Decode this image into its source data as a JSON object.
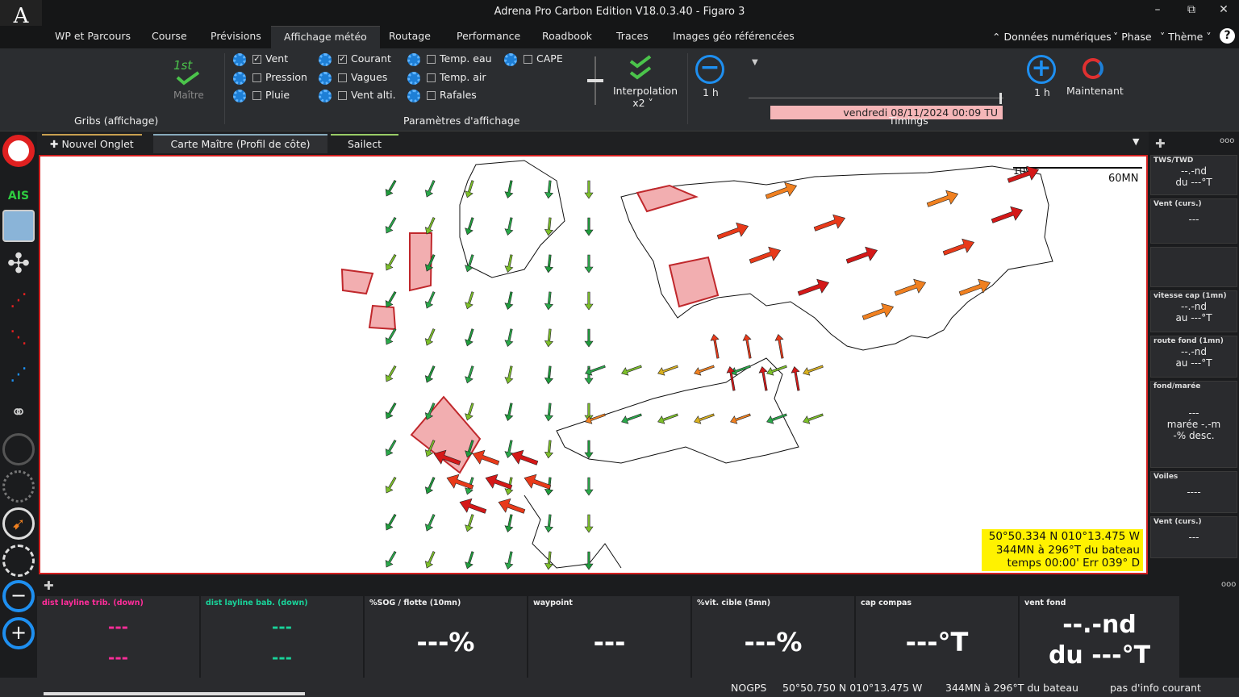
{
  "app": {
    "logo": "A",
    "title": "Adrena Pro Carbon Edition V18.0.3.40 - Figaro 3",
    "min": "–",
    "restore": "⧉",
    "close": "✕"
  },
  "menu": {
    "tabs": [
      "WP et Parcours",
      "Course",
      "Prévisions",
      "Affichage météo",
      "Routage",
      "Performance",
      "Roadbook",
      "Traces",
      "Images géo référencées"
    ],
    "right": [
      "Données numériques",
      "Phase",
      "Thème"
    ],
    "help": "?"
  },
  "ribbon": {
    "gribs": {
      "label": "Gribs (affichage)",
      "master_icon": "1st",
      "master": "Maître"
    },
    "params": {
      "label": "Paramètres d'affichage",
      "items": [
        {
          "label": "Vent",
          "checked": "✓"
        },
        {
          "label": "Pression",
          "checked": ""
        },
        {
          "label": "Pluie",
          "checked": ""
        },
        {
          "label": "Courant",
          "checked": "✓"
        },
        {
          "label": "Vagues",
          "checked": ""
        },
        {
          "label": "Vent alti.",
          "checked": ""
        },
        {
          "label": "Temp. eau",
          "checked": ""
        },
        {
          "label": "Temp. air",
          "checked": ""
        },
        {
          "label": "Rafales",
          "checked": ""
        },
        {
          "label": "CAPE",
          "checked": ""
        }
      ],
      "interp": "Interpolation",
      "interp2": "x2"
    },
    "timings": {
      "label": "Timings",
      "date": "vendredi 08/11/2024 00:09 TU",
      "minus": "1 h",
      "plus": "1 h",
      "now": "Maintenant"
    }
  },
  "tabs": {
    "new": "Nouvel Onglet",
    "main": "Carte Maître (Profil de côte)",
    "sailect": "Sailect"
  },
  "map": {
    "scale": "60MN",
    "scale_start": "109",
    "coord": [
      "50°50.334 N  010°13.475 W",
      "344MN à 296°T du bateau",
      "temps 00:00' Err 039° D"
    ]
  },
  "right_panels": [
    {
      "title": "TWS/TWD",
      "lines": [
        "--.-nd",
        "du ---°T"
      ]
    },
    {
      "title": "Vent (curs.)",
      "lines": [
        "---"
      ]
    },
    {
      "title": "vitesse cap (1mn)",
      "lines": [
        "--.-nd",
        "au ---°T"
      ]
    },
    {
      "title": "route fond (1mn)",
      "lines": [
        "--.-nd",
        "au ---°T"
      ]
    },
    {
      "title": "fond/marée",
      "lines": [
        "---",
        "marée -.-m",
        "-% desc."
      ]
    },
    {
      "title": "Voiles",
      "lines": [
        "----"
      ]
    },
    {
      "title": "Vent (curs.)",
      "lines": [
        "---"
      ]
    }
  ],
  "bottom_panels": [
    {
      "title": "dist layline trib. (down)",
      "lines": [
        "---",
        "---"
      ],
      "color": "#ff2d9a"
    },
    {
      "title": "dist layline bab. (down)",
      "lines": [
        "---",
        "---"
      ],
      "color": "#19d39a"
    },
    {
      "title": "%SOG / flotte (10mn)",
      "lines": [
        "---%"
      ],
      "color": "#ffffff"
    },
    {
      "title": "waypoint",
      "lines": [
        "---"
      ],
      "color": "#ffffff"
    },
    {
      "title": "%vit. cible (5mn)",
      "lines": [
        "---%"
      ],
      "color": "#ffffff"
    },
    {
      "title": "cap compas",
      "lines": [
        "---°T"
      ],
      "color": "#ffffff"
    },
    {
      "title": "vent fond",
      "lines": [
        "--.-nd",
        "du ---°T"
      ],
      "color": "#ffffff"
    }
  ],
  "status": {
    "gps": "NOGPS",
    "pos": "50°50.750 N  010°13.475 W",
    "dist": "344MN à 296°T du bateau",
    "info": "pas d'info courant"
  },
  "colors": {
    "accent": "#1e7fd6",
    "map_border": "#d42020",
    "coord_bg": "#fff200",
    "date_bg": "#f5b6b8"
  }
}
